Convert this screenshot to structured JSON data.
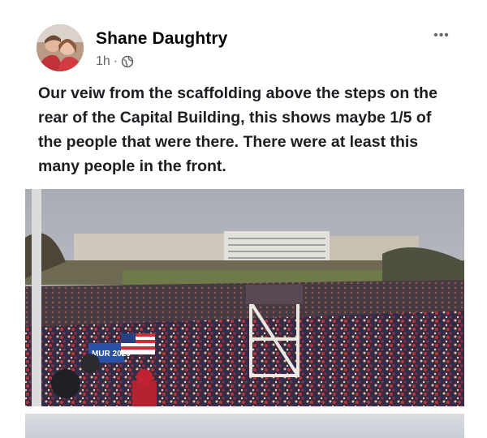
{
  "post": {
    "author": "Shane Daughtry",
    "time": "1h",
    "separator": "·",
    "privacy_icon": "globe-icon",
    "more_icon": "more-options-icon",
    "more_label": "•••",
    "text": "Our veiw from the scaffolding above the steps on the rear of the Capital Building, this shows maybe 1/5 of the people that were there. There were at least this many people in the front.",
    "photo_sign_text": "MUR 2020"
  },
  "colors": {
    "text_primary": "#050505",
    "text_secondary": "#65676b",
    "background": "#ffffff"
  }
}
